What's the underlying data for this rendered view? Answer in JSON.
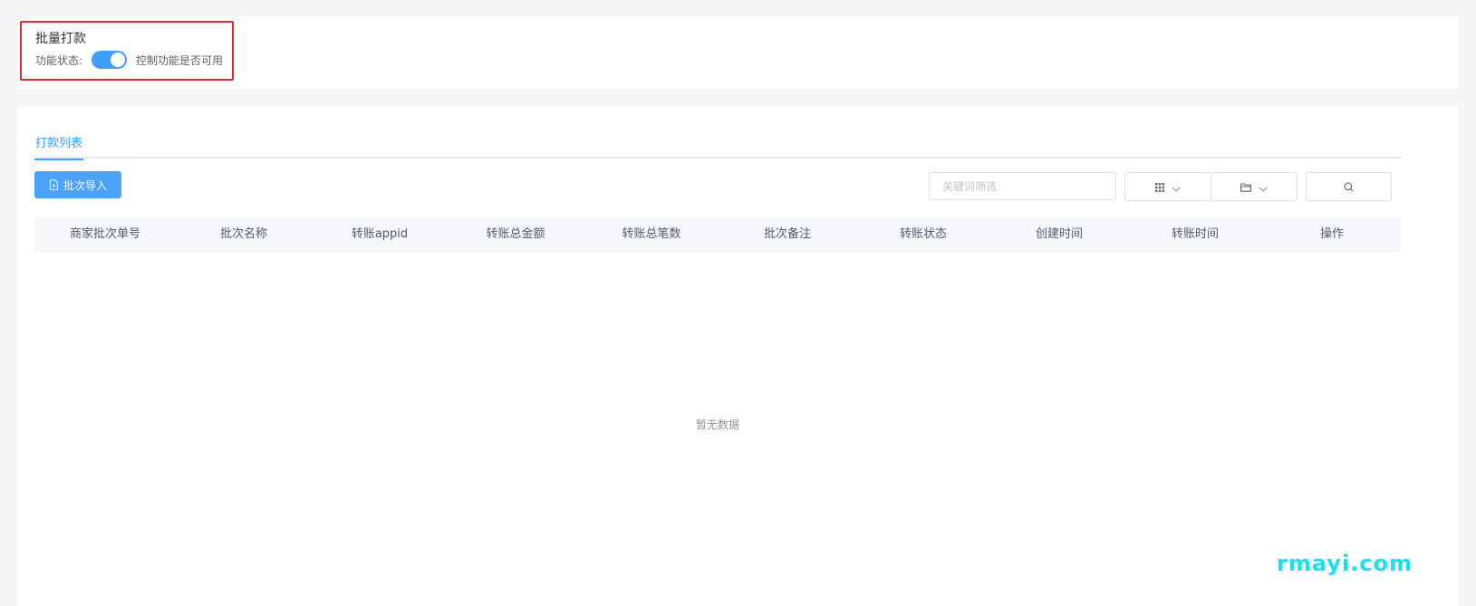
{
  "feature": {
    "title": "批量打款",
    "status_label": "功能状态:",
    "switch_on": true,
    "switch_hint": "控制功能是否可用"
  },
  "tabs": [
    {
      "label": "打款列表",
      "active": true
    }
  ],
  "toolbar": {
    "import_label": "批次导入",
    "search_placeholder": "关键词筛选"
  },
  "table": {
    "columns": [
      "商家批次单号",
      "批次名称",
      "转账appid",
      "转账总金额",
      "转账总笔数",
      "批次备注",
      "转账状态",
      "创建时间",
      "转账时间",
      "操作"
    ],
    "rows": [],
    "empty_text": "暂无数据"
  },
  "watermark": "rmayi.com",
  "colors": {
    "accent": "#409eff",
    "highlight_border": "#e3262f",
    "watermark": "#12e3ee"
  },
  "icons": {
    "import": "file-import-icon",
    "columns": "grid-icon",
    "export": "folder-icon",
    "search": "search-icon",
    "dropdown": "chevron-down-icon"
  }
}
